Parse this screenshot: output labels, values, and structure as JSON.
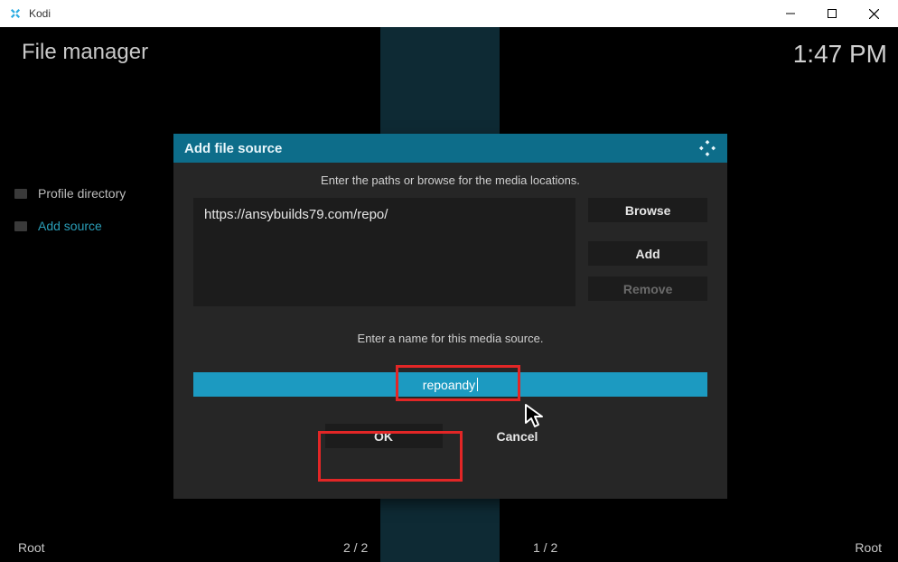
{
  "window": {
    "title": "Kodi"
  },
  "header": {
    "title": "File manager",
    "clock": "1:47 PM"
  },
  "left_list": {
    "profile": "Profile directory",
    "add": "Add source"
  },
  "dialog": {
    "title": "Add file source",
    "instruction_paths": "Enter the paths or browse for the media locations.",
    "path_value": "https://ansybuilds79.com/repo/",
    "browse": "Browse",
    "add": "Add",
    "remove": "Remove",
    "instruction_name": "Enter a name for this media source.",
    "name_value": "repoandy",
    "ok": "OK",
    "cancel": "Cancel"
  },
  "footer": {
    "left": "Root",
    "pager1": "2 / 2",
    "pager2": "1 / 2",
    "right": "Root"
  }
}
